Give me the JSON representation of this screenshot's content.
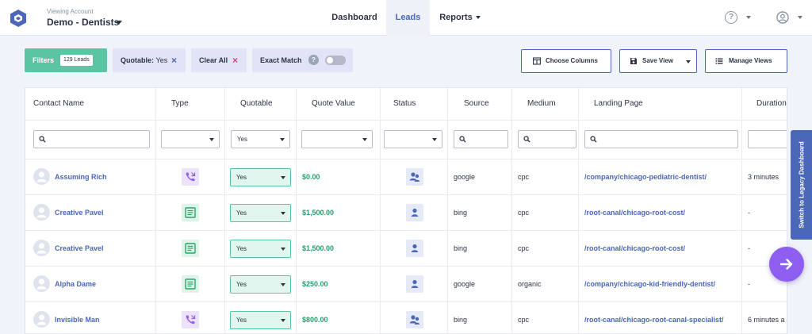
{
  "header": {
    "account_caption": "Viewing Account",
    "account_name": "Demo - Dentists",
    "nav": [
      {
        "label": "Dashboard"
      },
      {
        "label": "Leads"
      },
      {
        "label": "Reports"
      }
    ],
    "help_glyph": "?"
  },
  "filters": {
    "filters_label": "Filters",
    "leads_count": "129 Leads",
    "quotable_label": "Quotable:",
    "quotable_value": "Yes",
    "clear_all_label": "Clear All",
    "exact_match_label": "Exact Match",
    "remove_glyph": "×"
  },
  "toolbar": {
    "choose_columns_label": "Choose Columns",
    "save_view_label": "Save View",
    "manage_views_label": "Manage Views"
  },
  "table": {
    "columns": [
      "Contact Name",
      "Type",
      "Quotable",
      "Quote Value",
      "Status",
      "Source",
      "Medium",
      "Landing Page",
      "Duration"
    ],
    "filter_quotable_value": "Yes",
    "rows": [
      {
        "name": "Assuming Rich",
        "type": "call",
        "quotable": "Yes",
        "quote_value": "$0.00",
        "status": "group",
        "source": "google",
        "medium": "cpc",
        "landing_page": "/company/chicago-pediatric-dentist/",
        "duration": "3 minutes"
      },
      {
        "name": "Creative Pavel",
        "type": "form",
        "quotable": "Yes",
        "quote_value": "$1,500.00",
        "status": "person",
        "source": "bing",
        "medium": "cpc",
        "landing_page": "/root-canal/chicago-root-cost/",
        "duration": "-"
      },
      {
        "name": "Creative Pavel",
        "type": "form",
        "quotable": "Yes",
        "quote_value": "$1,500.00",
        "status": "person",
        "source": "bing",
        "medium": "cpc",
        "landing_page": "/root-canal/chicago-root-cost/",
        "duration": "-"
      },
      {
        "name": "Alpha Dame",
        "type": "form",
        "quotable": "Yes",
        "quote_value": "$250.00",
        "status": "person",
        "source": "google",
        "medium": "organic",
        "landing_page": "/company/chicago-kid-friendly-dentist/",
        "duration": "-"
      },
      {
        "name": "Invisible Man",
        "type": "call",
        "quotable": "Yes",
        "quote_value": "$800.00",
        "status": "group",
        "source": "bing",
        "medium": "cpc",
        "landing_page": "/root-canal/chicago-root-canal-specialist/",
        "duration": "6 minutes a"
      }
    ]
  },
  "side": {
    "legacy_label": "Switch to Legacy Dashboard"
  },
  "colors": {
    "accent": "#4a67b8",
    "filters_green": "#5bc4a2",
    "money_green": "#24a06b",
    "call_purple": "#8d5ef0",
    "fab_purple": "#8d5ef0"
  }
}
